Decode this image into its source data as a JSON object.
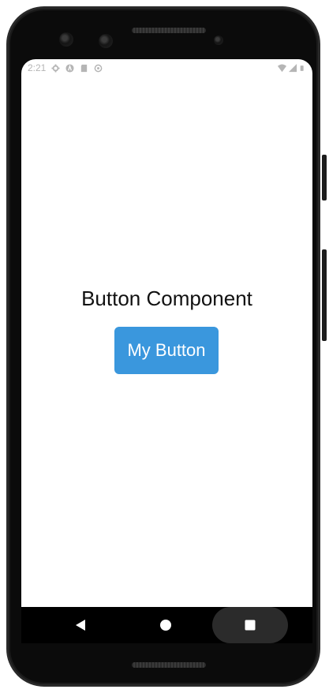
{
  "status_bar": {
    "time": "2:21",
    "left_icons": [
      "settings-icon",
      "a11y-icon",
      "sd-card-icon",
      "sync-icon"
    ],
    "right_icons": [
      "wifi-icon",
      "signal-icon",
      "battery-icon"
    ]
  },
  "main": {
    "title": "Button Component",
    "button_label": "My Button"
  },
  "nav_bar": {
    "items": [
      "back-icon",
      "home-icon",
      "recents-icon"
    ]
  },
  "colors": {
    "button": "#3a97dd",
    "background": "#ffffff",
    "frame": "#0b0b0b"
  }
}
